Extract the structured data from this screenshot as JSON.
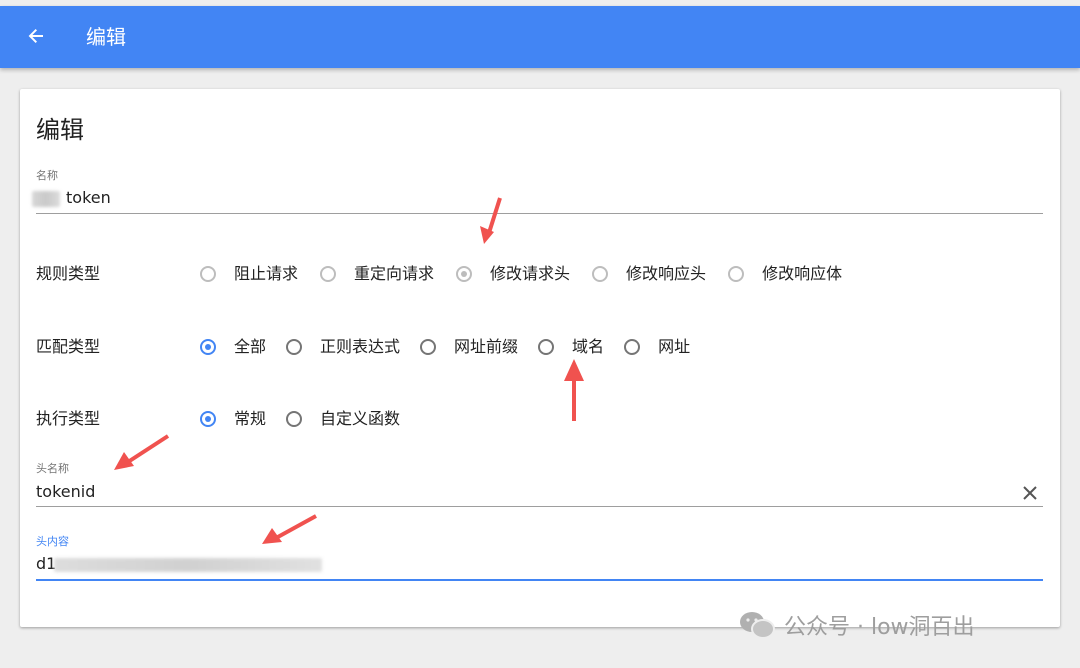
{
  "appbar": {
    "title": "编辑",
    "back_icon": "arrow-left-icon",
    "color": "#4285f4"
  },
  "card": {
    "title": "编辑"
  },
  "name_field": {
    "label": "名称",
    "value": "token"
  },
  "rule_type": {
    "label": "规则类型",
    "options": [
      "阻止请求",
      "重定向请求",
      "修改请求头",
      "修改响应头",
      "修改响应体"
    ],
    "selected": "修改请求头"
  },
  "match_type": {
    "label": "匹配类型",
    "options": [
      "全部",
      "正则表达式",
      "网址前缀",
      "域名",
      "网址"
    ],
    "selected": "全部"
  },
  "exec_type": {
    "label": "执行类型",
    "options": [
      "常规",
      "自定义函数"
    ],
    "selected": "常规"
  },
  "header_name_field": {
    "label": "头名称",
    "value": "tokenid",
    "clear_icon": "close-icon"
  },
  "header_value_field": {
    "label": "头内容",
    "value": "d1"
  },
  "watermark": {
    "text": "公众号 · low洞百出"
  },
  "accent_color": "#4285f4",
  "annotation_color": "#f0524f"
}
